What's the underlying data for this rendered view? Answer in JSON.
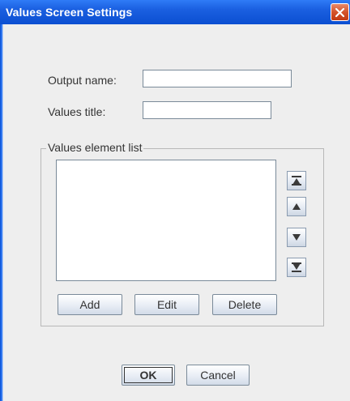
{
  "window": {
    "title": "Values Screen Settings"
  },
  "form": {
    "output_name_label": "Output name:",
    "output_name_value": "",
    "values_title_label": "Values title:",
    "values_title_value": ""
  },
  "list_group": {
    "title": "Values element list",
    "items": [],
    "move_buttons": [
      "move-top",
      "move-up",
      "move-down",
      "move-bottom"
    ]
  },
  "list_actions": {
    "add": "Add",
    "edit": "Edit",
    "delete": "Delete"
  },
  "dialog_buttons": {
    "ok": "OK",
    "cancel": "Cancel"
  },
  "colors": {
    "titlebar": "#1a5fe0",
    "close": "#d4532a",
    "client": "#eeeeee"
  }
}
